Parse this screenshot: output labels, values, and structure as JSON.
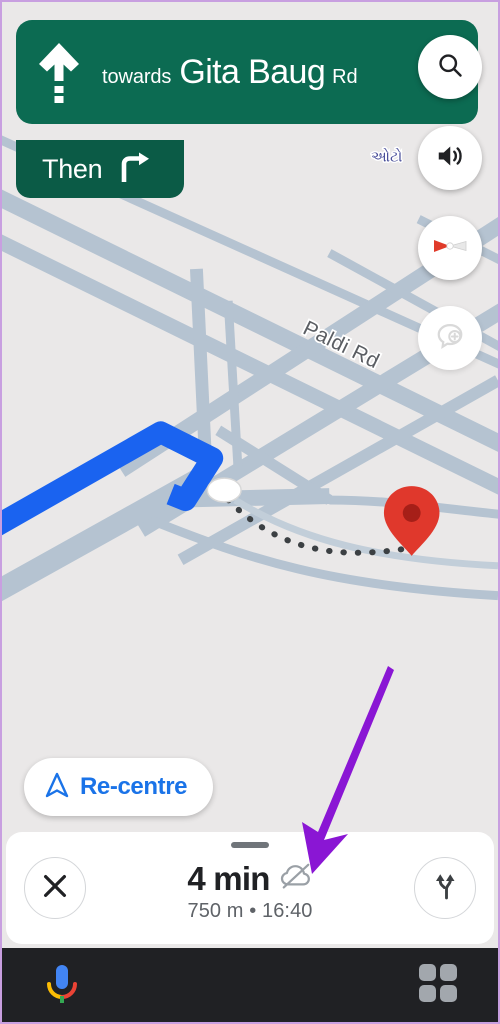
{
  "app": {
    "name": "Google Maps Navigation",
    "screen": "turn-by-turn-navigation"
  },
  "nav_banner": {
    "maneuver_icon": "straight-arrow-icon",
    "towards_word": "towards",
    "street_name": "Gita Baug",
    "street_suffix": "Rd",
    "background_color": "#0c6b52",
    "text_color": "#ffffff"
  },
  "then_banner": {
    "label": "Then",
    "maneuver_icon": "turn-right-icon",
    "background_color": "#0b5b46"
  },
  "map_controls": [
    {
      "name": "search-button",
      "icon": "search-icon",
      "label": "Search"
    },
    {
      "name": "sound-button",
      "icon": "volume-on-icon",
      "label": "Sound"
    },
    {
      "name": "compass-button",
      "icon": "compass-icon",
      "label": "Compass"
    },
    {
      "name": "report-button",
      "icon": "add-report-icon",
      "label": "Report incident"
    }
  ],
  "recentre": {
    "label": "Re-centre",
    "icon": "navigation-arrow-icon",
    "accent_color": "#1a73e8"
  },
  "map": {
    "road_labels": [
      {
        "text": "Paldi Rd",
        "color": "#5b5e63"
      },
      {
        "text": "ઓટો",
        "color": "#4a4f9a"
      }
    ],
    "route_color": "#1a63f0",
    "road_color": "#b5c3d1",
    "background_color": "#eae8e8",
    "destination_marker": {
      "icon": "destination-pin-icon",
      "color": "#e0382c"
    },
    "vehicle_marker": {
      "icon": "vehicle-chevron-icon",
      "color": "#ffffff"
    },
    "walking_path": {
      "style": "dotted",
      "color": "#3c4043"
    }
  },
  "bottom_sheet": {
    "handle": "drag-handle",
    "close_button": {
      "icon": "close-icon",
      "label": "Close navigation"
    },
    "routes_button": {
      "icon": "alternate-routes-icon",
      "label": "Alternate routes"
    },
    "eta_time": "4 min",
    "eta_status_icon": "cloud-off-icon",
    "distance": "750 m",
    "separator": "•",
    "arrival_time": "16:40",
    "eta_subtext": "750 m  •  16:40"
  },
  "system_bar": {
    "assistant_button": {
      "icon": "google-assistant-mic-icon",
      "label": "Assistant"
    },
    "apps_button": {
      "icon": "app-grid-icon",
      "label": "All apps"
    },
    "background_color": "#202124"
  },
  "annotation": {
    "arrow": {
      "icon": "pointer-arrow-icon",
      "color": "#8a16d4",
      "points_to": "cloud-off-icon"
    }
  }
}
